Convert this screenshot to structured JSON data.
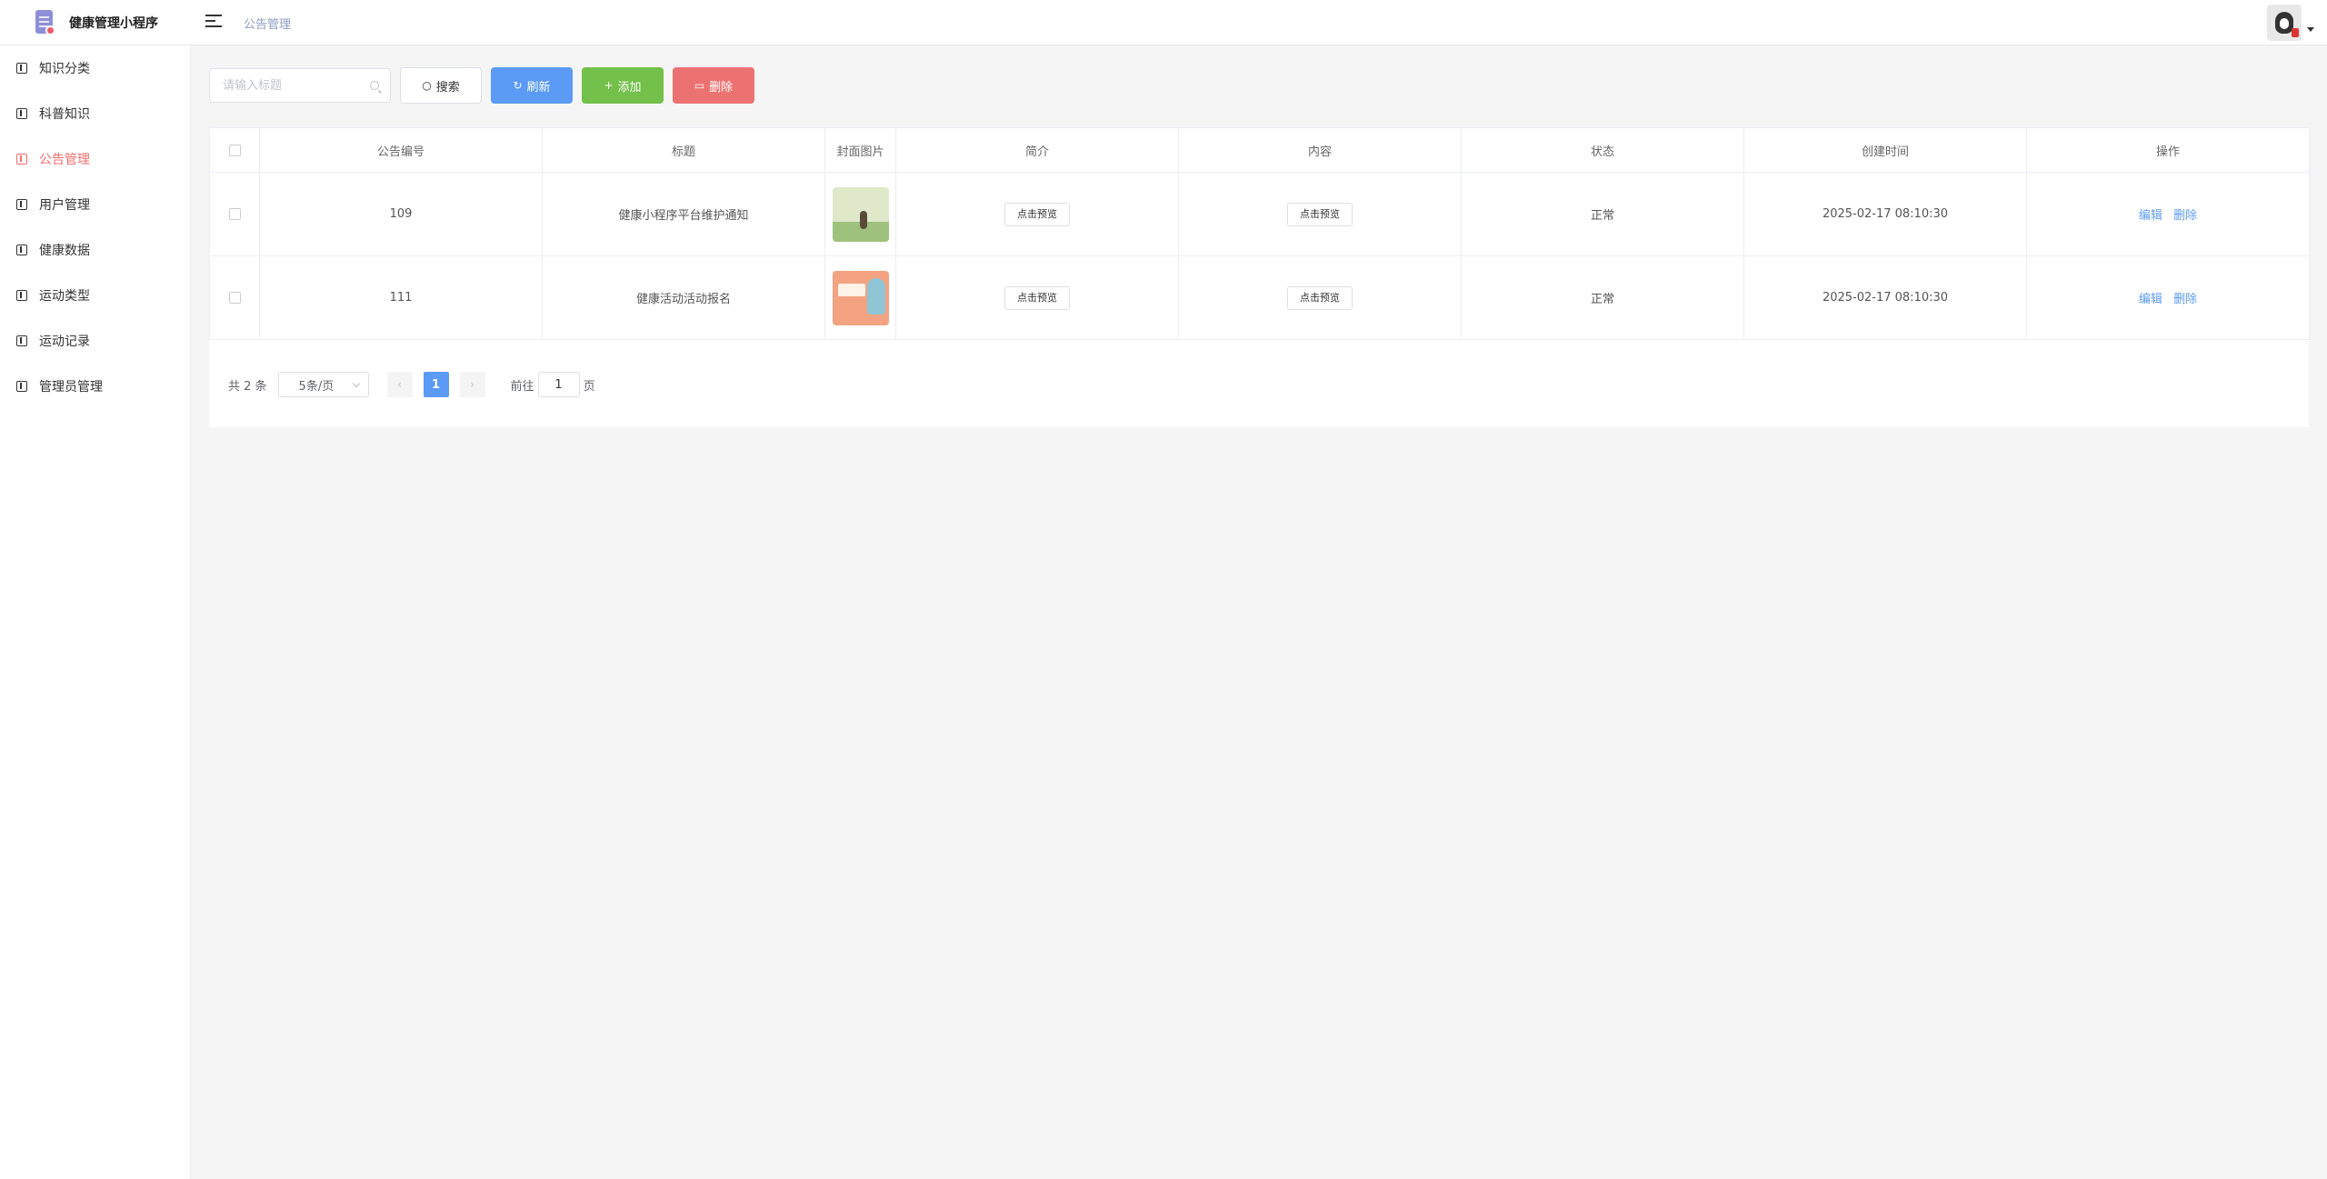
{
  "app": {
    "title": "健康管理小程序"
  },
  "breadcrumb": "公告管理",
  "sidebar": {
    "items": [
      {
        "label": "知识分类",
        "active": false
      },
      {
        "label": "科普知识",
        "active": false
      },
      {
        "label": "公告管理",
        "active": true
      },
      {
        "label": "用户管理",
        "active": false
      },
      {
        "label": "健康数据",
        "active": false
      },
      {
        "label": "运动类型",
        "active": false
      },
      {
        "label": "运动记录",
        "active": false
      },
      {
        "label": "管理员管理",
        "active": false
      }
    ]
  },
  "toolbar": {
    "search_placeholder": "请输入标题",
    "search_value": "",
    "search_label": "搜索",
    "refresh_label": "刷新",
    "add_label": "添加",
    "delete_label": "删除"
  },
  "table": {
    "columns": [
      "公告编号",
      "标题",
      "封面图片",
      "简介",
      "内容",
      "状态",
      "创建时间",
      "操作"
    ],
    "rows": [
      {
        "id": "109",
        "title": "健康小程序平台维护通知",
        "cover": "cover-image-green",
        "summary_btn": "点击预览",
        "content_btn": "点击预览",
        "status": "正常",
        "created": "2025-02-17 08:10:30",
        "edit": "编辑",
        "delete": "删除"
      },
      {
        "id": "111",
        "title": "健康活动活动报名",
        "cover": "cover-image-orange",
        "summary_btn": "点击预览",
        "content_btn": "点击预览",
        "status": "正常",
        "created": "2025-02-17 08:10:30",
        "edit": "编辑",
        "delete": "删除"
      }
    ]
  },
  "pagination": {
    "total_text": "共 2 条",
    "page_size": "5条/页",
    "current_page": "1",
    "goto_label": "前往",
    "goto_value": "1",
    "page_unit": "页"
  },
  "colors": {
    "primary": "#5b9af5",
    "success": "#73c04a",
    "danger": "#ec7272",
    "active_nav": "#f56c6c"
  }
}
